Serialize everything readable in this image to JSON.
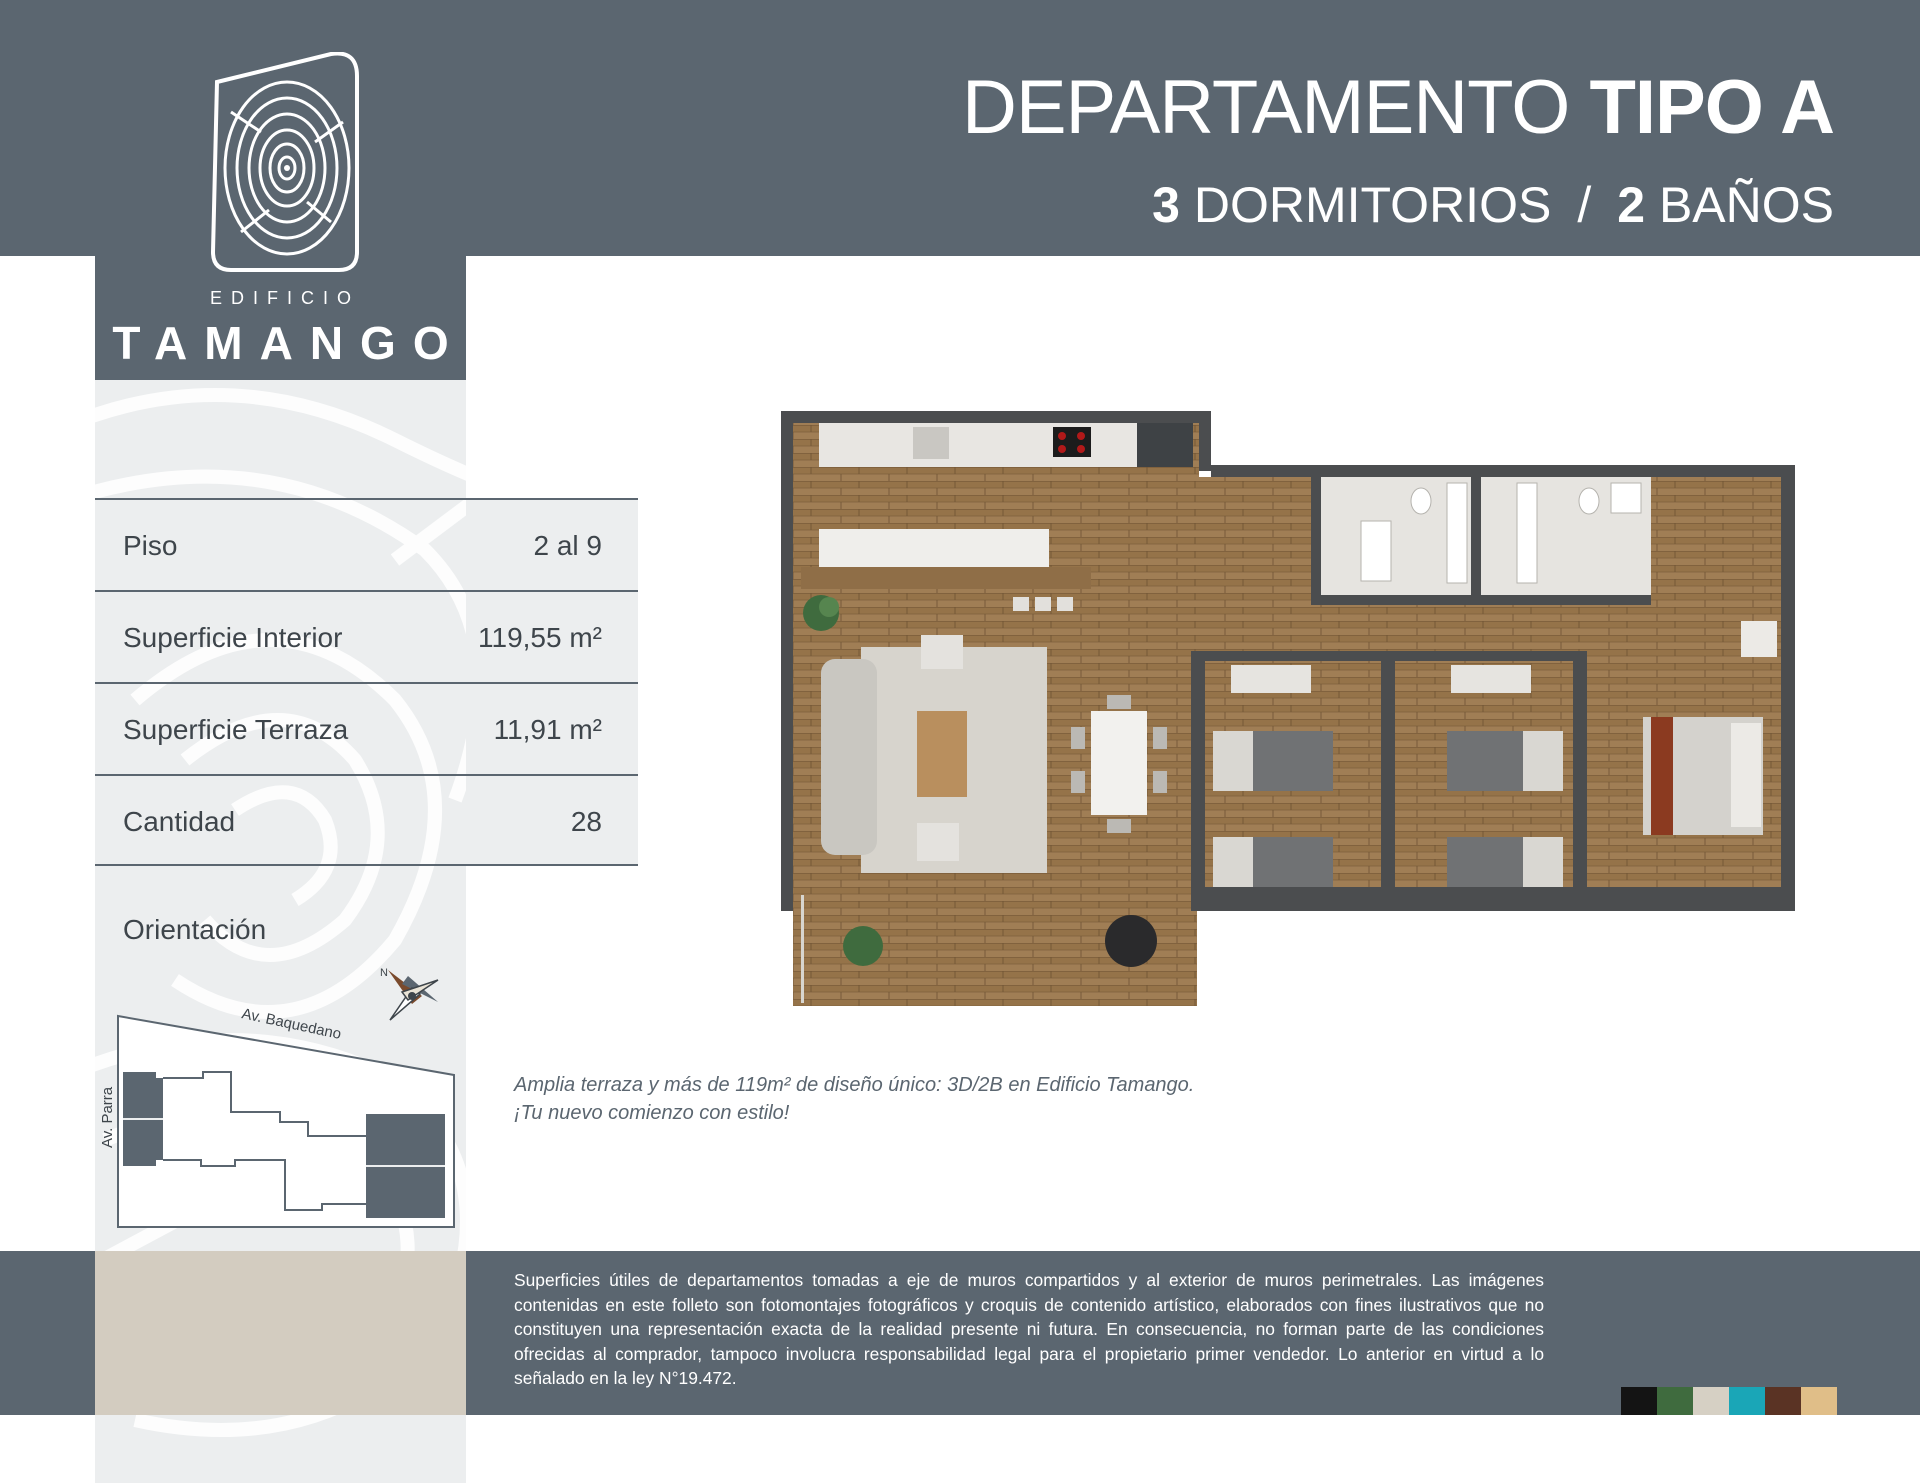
{
  "header": {
    "title_light": "DEPARTAMENTO",
    "title_bold": "TIPO A",
    "bedrooms_count": "3",
    "bedrooms_label": "DORMITORIOS",
    "separator": "/",
    "bathrooms_count": "2",
    "bathrooms_label": "BAÑOS"
  },
  "logo": {
    "subtitle": "EDIFICIO",
    "name": "TAMANGO"
  },
  "specs": [
    {
      "label": "Piso",
      "value": "2 al 9"
    },
    {
      "label": "Superficie Interior",
      "value": "119,55 m²"
    },
    {
      "label": "Superficie Terraza",
      "value": "11,91 m²"
    },
    {
      "label": "Cantidad",
      "value": "28"
    }
  ],
  "orientation": {
    "label": "Orientación",
    "street_top": "Av. Baquedano",
    "street_left": "Av. Parra",
    "compass_letter": "N"
  },
  "caption": {
    "line1": "Amplia terraza y más de 119m² de diseño único: 3D/2B en Edificio Tamango.",
    "line2": "¡Tu nuevo comienzo con estilo!"
  },
  "disclaimer": "Superficies útiles de departamentos tomadas a eje de muros compartidos y al exterior de muros perimetrales. Las imágenes contenidas en este folleto son fotomontajes fotográficos y croquis de contenido artístico, elaborados con fines ilustrativos que no constituyen una representación exacta de la realidad presente ni futura. En consecuencia, no forman parte de las condiciones ofrecidas al comprador, tampoco involucra responsabilidad legal para el propietario primer vendedor. Lo anterior en virtud a lo señalado en la ley N°19.472.",
  "colors": {
    "brand_slate": "#5b6670",
    "panel_light": "#eceeef",
    "beige": "#d3ccc0",
    "wood": "#9b7a52"
  },
  "palette_swatches": [
    "#141414",
    "#3f6b3e",
    "#d6d0c4",
    "#1aa6b7",
    "#5a3324",
    "#e0be88"
  ]
}
